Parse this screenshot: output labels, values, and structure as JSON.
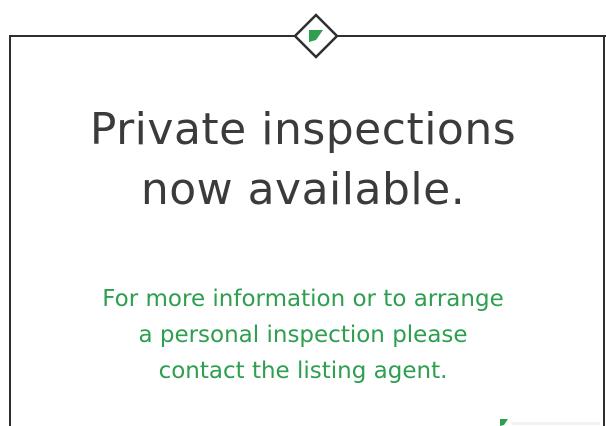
{
  "headline": {
    "line1": "Private inspections",
    "line2": "now available."
  },
  "message": {
    "line1": "For more information or to arrange",
    "line2": "a personal inspection please",
    "line3": "contact the listing agent."
  },
  "colors": {
    "headline": "#3b3b3b",
    "accent_green": "#2e9e4f",
    "frame": "#2e2e2e",
    "background": "#ffffff"
  },
  "icons": {
    "top_emblem": "diamond-flag-icon",
    "bottom_corner": "flag-fragment-icon"
  }
}
